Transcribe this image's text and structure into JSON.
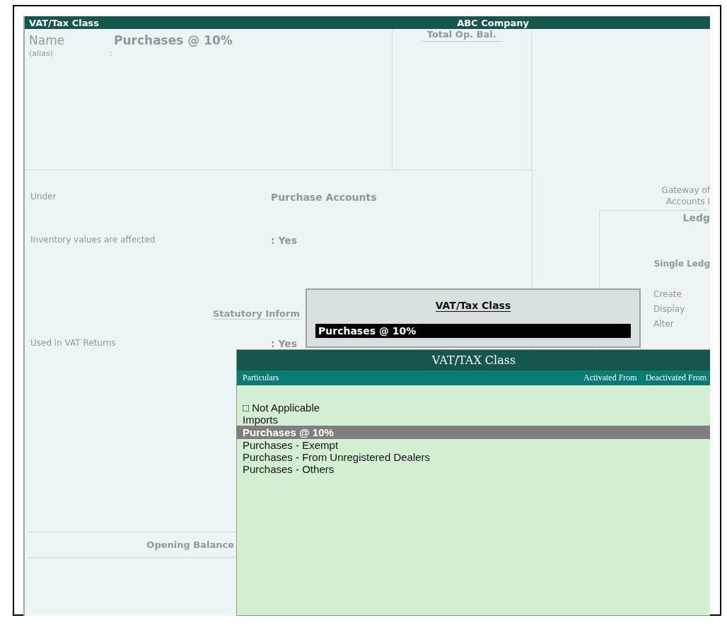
{
  "window": {
    "title": "VAT/Tax Class",
    "company": "ABC Company"
  },
  "form": {
    "name_label": "Name",
    "name_value": "Purchases @ 10%",
    "alias_label": "(alias)",
    "alias_sep": ":",
    "total_label": "Total Op. Bal.",
    "fields": [
      {
        "kind": "field",
        "label": "Under",
        "value": "Purchase Accounts"
      },
      {
        "kind": "field",
        "label": "Inventory values are affected",
        "value": ": Yes"
      },
      {
        "kind": "heading",
        "label": "Statutory Inform"
      },
      {
        "kind": "field",
        "label": "Used in VAT Returns",
        "value": ": Yes"
      }
    ],
    "opening_balance": "Opening Balance"
  },
  "gateway": {
    "title_lines": [
      "Gateway of",
      "Accounts I"
    ],
    "panel_title": "Ledg",
    "section": "Single Ledg",
    "menu": [
      "Create",
      "Display",
      "Alter"
    ]
  },
  "entry_popup": {
    "title": "VAT/Tax Class",
    "value": "Purchases @ 10%"
  },
  "list_popup": {
    "title": "VAT/TAX Class",
    "columns": [
      "Particulars",
      "Activated From",
      "Deactivated From"
    ],
    "items": [
      {
        "label": "□ Not Applicable",
        "selected": false
      },
      {
        "label": "Imports",
        "selected": false
      },
      {
        "label": "Purchases @ 10%",
        "selected": true
      },
      {
        "label": "Purchases - Exempt",
        "selected": false
      },
      {
        "label": "Purchases - From Unregistered Dealers",
        "selected": false
      },
      {
        "label": "Purchases - Others",
        "selected": false
      }
    ]
  }
}
